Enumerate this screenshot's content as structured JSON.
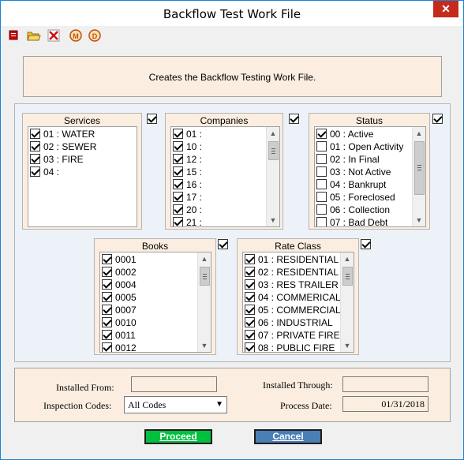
{
  "window": {
    "title": "Backflow Test Work File",
    "close_label": "✕"
  },
  "toolbar": [
    "report-icon",
    "open-folder-icon",
    "delete-icon",
    "m-circle-icon",
    "d-circle-icon"
  ],
  "description": "Creates the Backflow Testing Work File.",
  "services": {
    "title": "Services",
    "items": [
      {
        "label": "01 : WATER",
        "checked": true
      },
      {
        "label": "02 : SEWER",
        "checked": true
      },
      {
        "label": "03 : FIRE",
        "checked": true
      },
      {
        "label": "04 :",
        "checked": true
      }
    ]
  },
  "companies": {
    "title": "Companies",
    "items": [
      {
        "label": "01 :",
        "checked": true
      },
      {
        "label": "10 :",
        "checked": true
      },
      {
        "label": "12 :",
        "checked": true
      },
      {
        "label": "15 :",
        "checked": true
      },
      {
        "label": "16 :",
        "checked": true
      },
      {
        "label": "17 :",
        "checked": true
      },
      {
        "label": "20 :",
        "checked": true
      },
      {
        "label": "21 :",
        "checked": true
      }
    ]
  },
  "status": {
    "title": "Status",
    "items": [
      {
        "label": "00 : Active",
        "checked": true
      },
      {
        "label": "01 : Open Activity",
        "checked": false
      },
      {
        "label": "02 : In Final",
        "checked": false
      },
      {
        "label": "03 : Not Active",
        "checked": false
      },
      {
        "label": "04 : Bankrupt",
        "checked": false
      },
      {
        "label": "05 : Foreclosed",
        "checked": false
      },
      {
        "label": "06 : Collection",
        "checked": false
      },
      {
        "label": "07 : Bad Debt",
        "checked": false
      }
    ]
  },
  "books": {
    "title": "Books",
    "items": [
      {
        "label": "0001",
        "checked": true
      },
      {
        "label": "0002",
        "checked": true
      },
      {
        "label": "0004",
        "checked": true
      },
      {
        "label": "0005",
        "checked": true
      },
      {
        "label": "0007",
        "checked": true
      },
      {
        "label": "0010",
        "checked": true
      },
      {
        "label": "0011",
        "checked": true
      },
      {
        "label": "0012",
        "checked": true
      }
    ]
  },
  "rate_class": {
    "title": "Rate Class",
    "items": [
      {
        "label": "01 : RESIDENTIAL",
        "checked": true
      },
      {
        "label": "02 : RESIDENTIAL",
        "checked": true
      },
      {
        "label": "03 : RES TRAILER",
        "checked": true
      },
      {
        "label": "04 : COMMERICAL",
        "checked": true
      },
      {
        "label": "05 : COMMERCIAL",
        "checked": true
      },
      {
        "label": "06 : INDUSTRIAL",
        "checked": true
      },
      {
        "label": "07 : PRIVATE FIRE",
        "checked": true
      },
      {
        "label": "08 : PUBLIC FIRE",
        "checked": true
      }
    ]
  },
  "form": {
    "installed_from_label": "Installed From:",
    "installed_from_value": "",
    "installed_through_label": "Installed Through:",
    "installed_through_value": "",
    "inspection_codes_label": "Inspection Codes:",
    "inspection_codes_value": "All Codes",
    "process_date_label": "Process Date:",
    "process_date_value": "01/31/2018"
  },
  "buttons": {
    "proceed_label": "Proceed",
    "cancel_label": "Cancel",
    "proceed_color": "#00c040",
    "cancel_color": "#4a7fb5"
  }
}
